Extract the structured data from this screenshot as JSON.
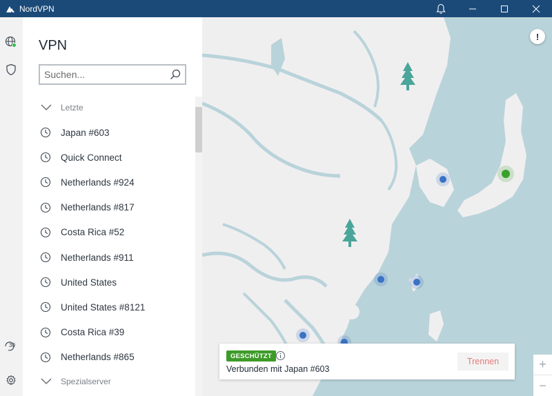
{
  "window": {
    "title": "NordVPN",
    "icons": {
      "logo": "nordvpn-logo-icon",
      "bell": "bell-icon",
      "minimize": "minimize-icon",
      "maximize": "maximize-icon",
      "close": "close-icon"
    }
  },
  "rail": {
    "items": [
      {
        "name": "globe-icon",
        "status_color": "#2fbf4a"
      },
      {
        "name": "shield-icon"
      }
    ],
    "bottom": [
      {
        "name": "timer-icon",
        "label": "30"
      },
      {
        "name": "gear-icon"
      }
    ]
  },
  "panel": {
    "title": "VPN",
    "search": {
      "placeholder": "Suchen...",
      "value": ""
    },
    "sections": [
      {
        "label": "Letzte"
      },
      {
        "label": "Spezialserver"
      }
    ],
    "recent": [
      "Japan #603",
      "Quick Connect",
      "Netherlands #924",
      "Netherlands #817",
      "Costa Rica #52",
      "Netherlands #911",
      "United States",
      "United States #8121",
      "Costa Rica #39",
      "Netherlands #865"
    ]
  },
  "map": {
    "alert_label": "!",
    "zoom": {
      "plus": "+",
      "minus": "−"
    },
    "colors": {
      "water": "#b9d3da",
      "land": "#f0eff0",
      "river": "#b9d3da",
      "server": "#3a72c4",
      "connected": "#3aa02c",
      "tree": "#4aa59a"
    }
  },
  "status": {
    "badge": "GESCHÜTZT",
    "text": "Verbunden mit Japan #603",
    "disconnect_label": "Trennen",
    "badge_color": "#3d9b29"
  }
}
